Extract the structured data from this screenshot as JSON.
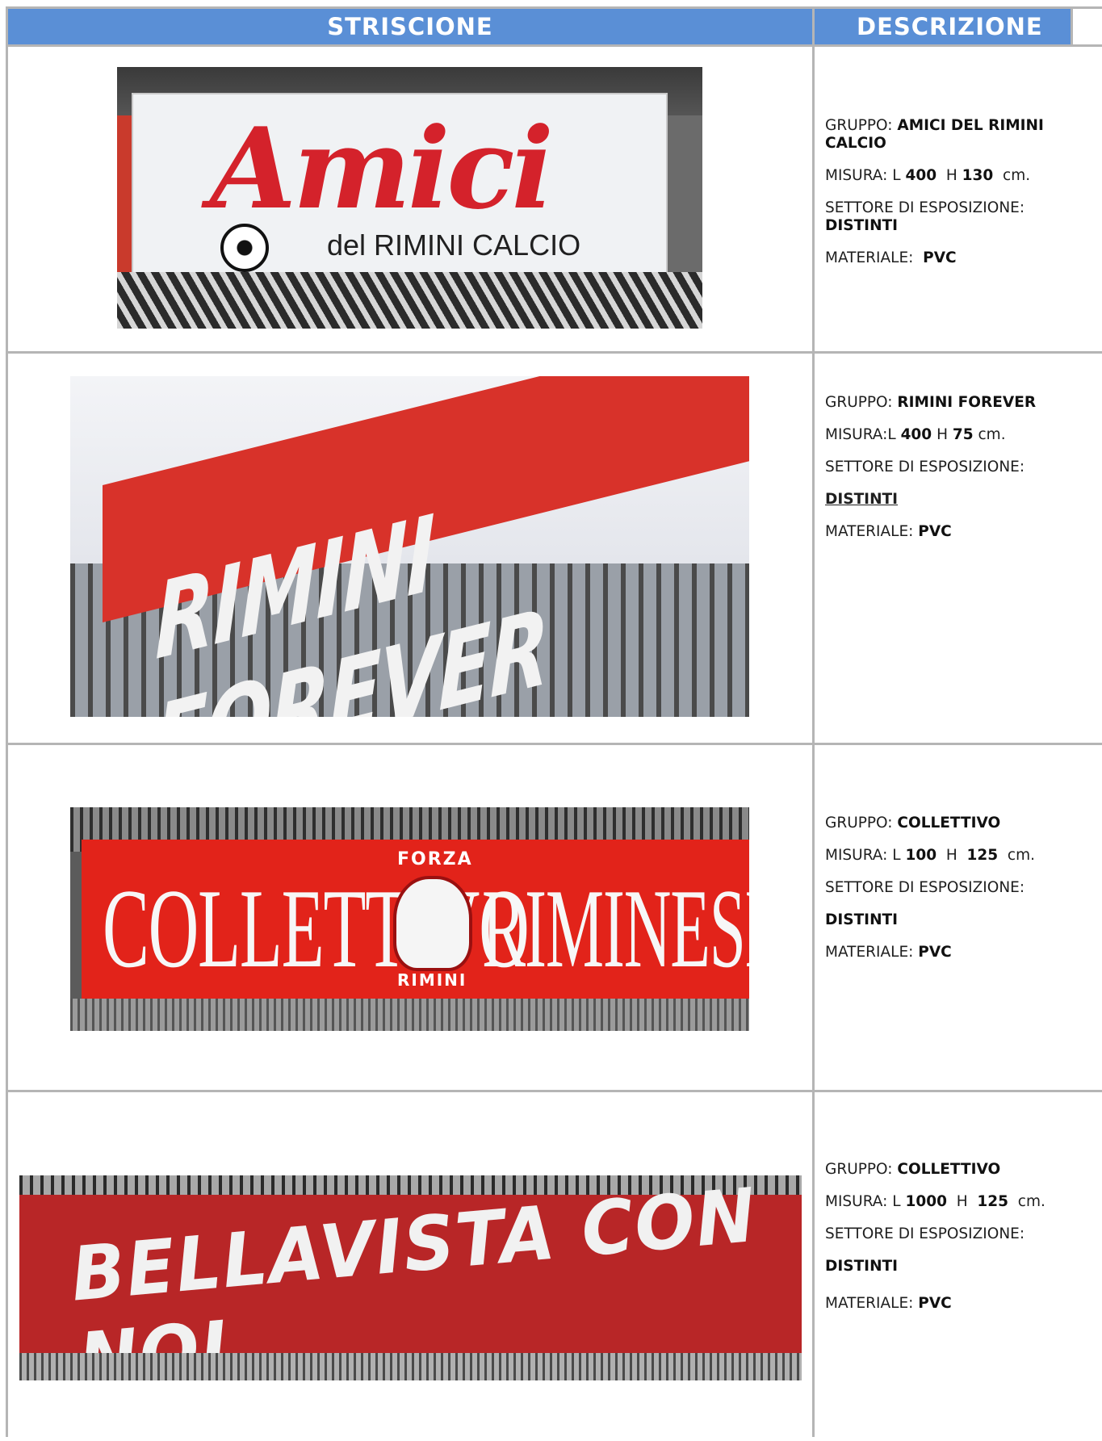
{
  "header": {
    "col1": "STRISCIONE",
    "col2": "DESCRIZIONE"
  },
  "labels": {
    "gruppo": "GRUPPO:",
    "misura": "MISURA:",
    "settore": "SETTORE DI ESPOSIZIONE:",
    "materiale": "MATERIALE:"
  },
  "rows": [
    {
      "banner_text": "Amici",
      "banner_sub": "del RIMINI CALCIO",
      "gruppo": "AMICI DEL RIMINI CALCIO",
      "misura_l": "400",
      "misura_h": "130",
      "unit": "cm.",
      "settore": "DISTINTI",
      "materiale": "PVC"
    },
    {
      "banner_text": "RIMINI FOREVER",
      "gruppo": "RIMINI FOREVER",
      "misura_l": "400",
      "misura_h": "75",
      "unit": "cm.",
      "settore": "DISTINTI",
      "materiale": "PVC"
    },
    {
      "banner_text_left": "COLLETTIVO",
      "banner_text_right": "RIMINESE",
      "banner_forza": "FORZA",
      "banner_rimini": "RIMINI",
      "gruppo": "COLLETTIVO",
      "misura_l": "100",
      "misura_h": "125",
      "unit": "cm.",
      "settore": "DISTINTI",
      "materiale": "PVC"
    },
    {
      "banner_text": "BELLAVISTA CON NOI",
      "gruppo": "COLLETTIVO",
      "misura_l": "1000",
      "misura_h": "125",
      "unit": "cm.",
      "settore": "DISTINTI",
      "materiale": "PVC"
    }
  ]
}
